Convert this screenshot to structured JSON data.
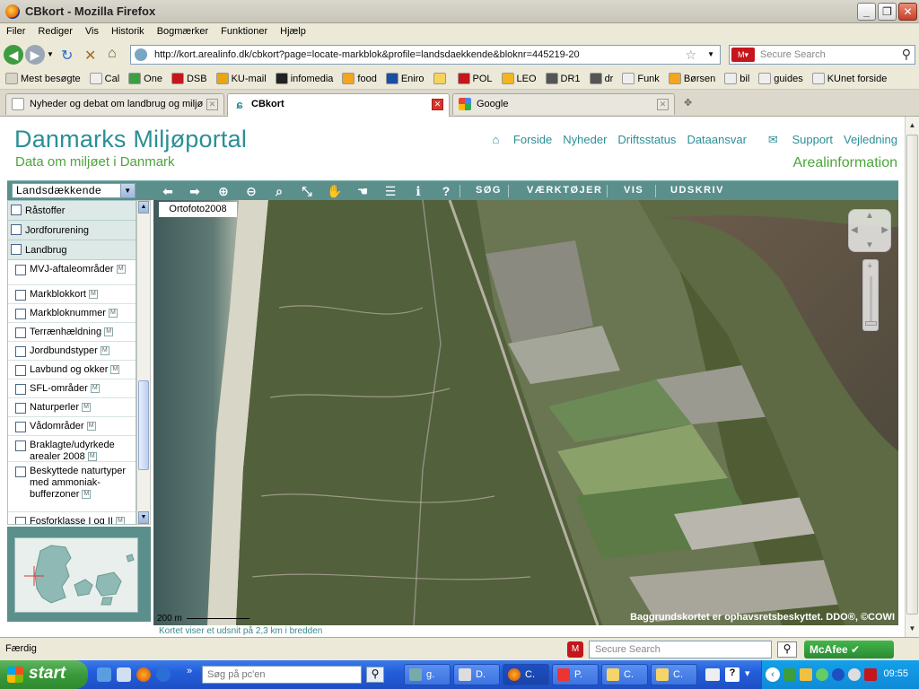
{
  "window": {
    "title": "CBkort - Mozilla Firefox",
    "minimize_icon": "minimize-icon",
    "restore_icon": "restore-icon",
    "close_icon": "close-icon"
  },
  "menu": [
    "Filer",
    "Rediger",
    "Vis",
    "Historik",
    "Bogmærker",
    "Funktioner",
    "Hjælp"
  ],
  "nav": {
    "url": "http://kort.arealinfo.dk/cbkort?page=locate-markblok&profile=landsdaekkende&bloknr=445219-20",
    "search_placeholder": "Secure Search"
  },
  "bookmarks": [
    {
      "label": "Mest besøgte",
      "color": "#d8d4c6"
    },
    {
      "label": "Cal",
      "color": "#eeeeee"
    },
    {
      "label": "One",
      "color": "#3aa041"
    },
    {
      "label": "DSB",
      "color": "#c4161c"
    },
    {
      "label": "KU-mail",
      "color": "#e7a614"
    },
    {
      "label": "infomedia",
      "color": "#222222"
    },
    {
      "label": "food",
      "color": "#f3a51f"
    },
    {
      "label": "Eniro",
      "color": "#1a4ea1"
    },
    {
      "label": "",
      "color": "#f6d45a"
    },
    {
      "label": "POL",
      "color": "#c4161c"
    },
    {
      "label": "LEO",
      "color": "#f3b51f"
    },
    {
      "label": "DR1",
      "color": "#555555"
    },
    {
      "label": "dr",
      "color": "#555555"
    },
    {
      "label": "Funk",
      "color": "#eeeeee"
    },
    {
      "label": "Børsen",
      "color": "#f3a51f"
    },
    {
      "label": "bil",
      "color": "#eeeeee"
    },
    {
      "label": "guides",
      "color": "#eeeeee"
    },
    {
      "label": "KUnet forside",
      "color": "#eeeeee"
    }
  ],
  "tabs": [
    {
      "label": "Nyheder og debat om landbrug og miljø",
      "active": false
    },
    {
      "label": "CBkort",
      "active": true
    },
    {
      "label": "Google",
      "active": false
    }
  ],
  "site": {
    "logo_title": "Danmarks Miljøportal",
    "logo_subtitle": "Data om miljøet i Danmark",
    "topnav": [
      "Forside",
      "Nyheder",
      "Driftsstatus",
      "Dataansvar",
      "Support",
      "Vejledning"
    ],
    "section_title": "Arealinformation"
  },
  "toolbar": {
    "profile_value": "Landsdækkende",
    "text_buttons": [
      "SØG",
      "VÆRKTØJER",
      "VIS",
      "UDSKRIV"
    ]
  },
  "layers": {
    "groups": [
      "Råstoffer",
      "Jordforurening",
      "Landbrug"
    ],
    "items": [
      "MVJ-aftaleområder",
      "Markblokkort",
      "Markbloknummer",
      "Terrænhældning",
      "Jordbundstyper",
      "Lavbund og okker",
      "SFL-områder",
      "Naturperler",
      "Vådområder",
      "Braklagte/udyrkede arealer 2008",
      "Beskyttede naturtyper med ammoniak-bufferzoner",
      "Fosforklasse I og II"
    ]
  },
  "map": {
    "layer_label": "Ortofoto2008",
    "scale_label": "200 m",
    "copyright": "Baggrundskortet er ophavsretsbeskyttet. DDO®, ©COWI",
    "note": "Kortet viser et udsnit på 2,3 km i bredden"
  },
  "status": {
    "text": "Færdig",
    "mcafee_placeholder": "Secure Search",
    "mcafee_label": "McAfee"
  },
  "taskbar": {
    "start": "start",
    "search_placeholder": "Søg på pc'en",
    "tasks": [
      "g.",
      "D.",
      "C.",
      "P.",
      "C.",
      "C."
    ],
    "clock": "09:55"
  }
}
